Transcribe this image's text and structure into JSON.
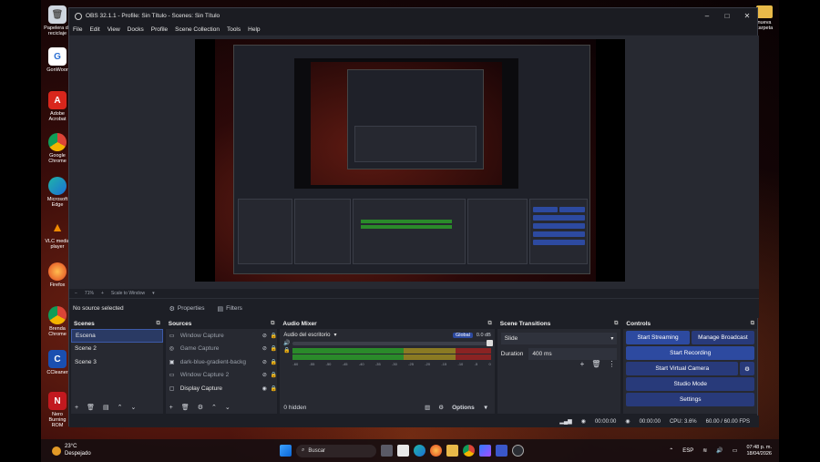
{
  "desktop": {
    "icons": [
      {
        "label": "Papelera de reciclaje",
        "icon": "recycle-bin-icon"
      },
      {
        "label": "GonWoor",
        "icon": "app-icon"
      },
      {
        "label": "Adobe Acrobat",
        "icon": "acrobat-icon"
      },
      {
        "label": "Google Chrome",
        "icon": "chrome-icon"
      },
      {
        "label": "Microsoft Edge",
        "icon": "edge-icon"
      },
      {
        "label": "VLC media player",
        "icon": "vlc-icon"
      },
      {
        "label": "Firefox",
        "icon": "firefox-icon"
      },
      {
        "label": "Brenda Chrome",
        "icon": "chrome-icon"
      },
      {
        "label": "CCleaner",
        "icon": "ccleaner-icon"
      },
      {
        "label": "Nero Burning ROM",
        "icon": "nero-icon"
      }
    ],
    "right_icon_label": "nueva carpeta"
  },
  "window": {
    "title": "OBS 32.1.1 - Profile: Sin Título - Scenes: Sin Título",
    "menu": [
      "File",
      "Edit",
      "View",
      "Docks",
      "Profile",
      "Scene Collection",
      "Tools",
      "Help"
    ]
  },
  "scalebar": {
    "zoom": "71%",
    "mode": "Scale to Window"
  },
  "context_bar": {
    "no_source": "No source selected",
    "properties": "Properties",
    "filters": "Filters"
  },
  "scenes": {
    "title": "Scenes",
    "items": [
      "Escena",
      "Scene 2",
      "Scene 3"
    ]
  },
  "sources": {
    "title": "Sources",
    "items": [
      {
        "name": "Window Capture"
      },
      {
        "name": "Game Capture"
      },
      {
        "name": "dark-blue-gradient-backg"
      },
      {
        "name": "Window Capture 2"
      },
      {
        "name": "Display Capture"
      }
    ]
  },
  "audio_mixer": {
    "title": "Audio Mixer",
    "channel": "Audio del escritorio",
    "global_label": "Global",
    "db_value": "0.0 dB",
    "ticks": [
      "-60",
      "-55",
      "-50",
      "-45",
      "-40",
      "-35",
      "-30",
      "-25",
      "-20",
      "-15",
      "-10",
      "-5",
      "0"
    ],
    "hidden": "0 hidden",
    "options": "Options"
  },
  "transitions": {
    "title": "Scene Transitions",
    "transition": "Slide",
    "duration_label": "Duration",
    "duration_value": "400 ms"
  },
  "controls": {
    "title": "Controls",
    "start_streaming": "Start Streaming",
    "manage_broadcast": "Manage Broadcast",
    "start_recording": "Start Recording",
    "start_virtual_camera": "Start Virtual Camera",
    "studio_mode": "Studio Mode",
    "settings": "Settings"
  },
  "status": {
    "stream_time": "00:00:00",
    "rec_time": "00:00:00",
    "cpu": "CPU: 3.6%",
    "fps": "60.00 / 60.00 FPS"
  },
  "taskbar": {
    "temp": "23°C",
    "weather": "Despejado",
    "search": "Buscar",
    "lang": "ESP",
    "time": "07:48 p. m.",
    "date": "18/04/2026"
  }
}
